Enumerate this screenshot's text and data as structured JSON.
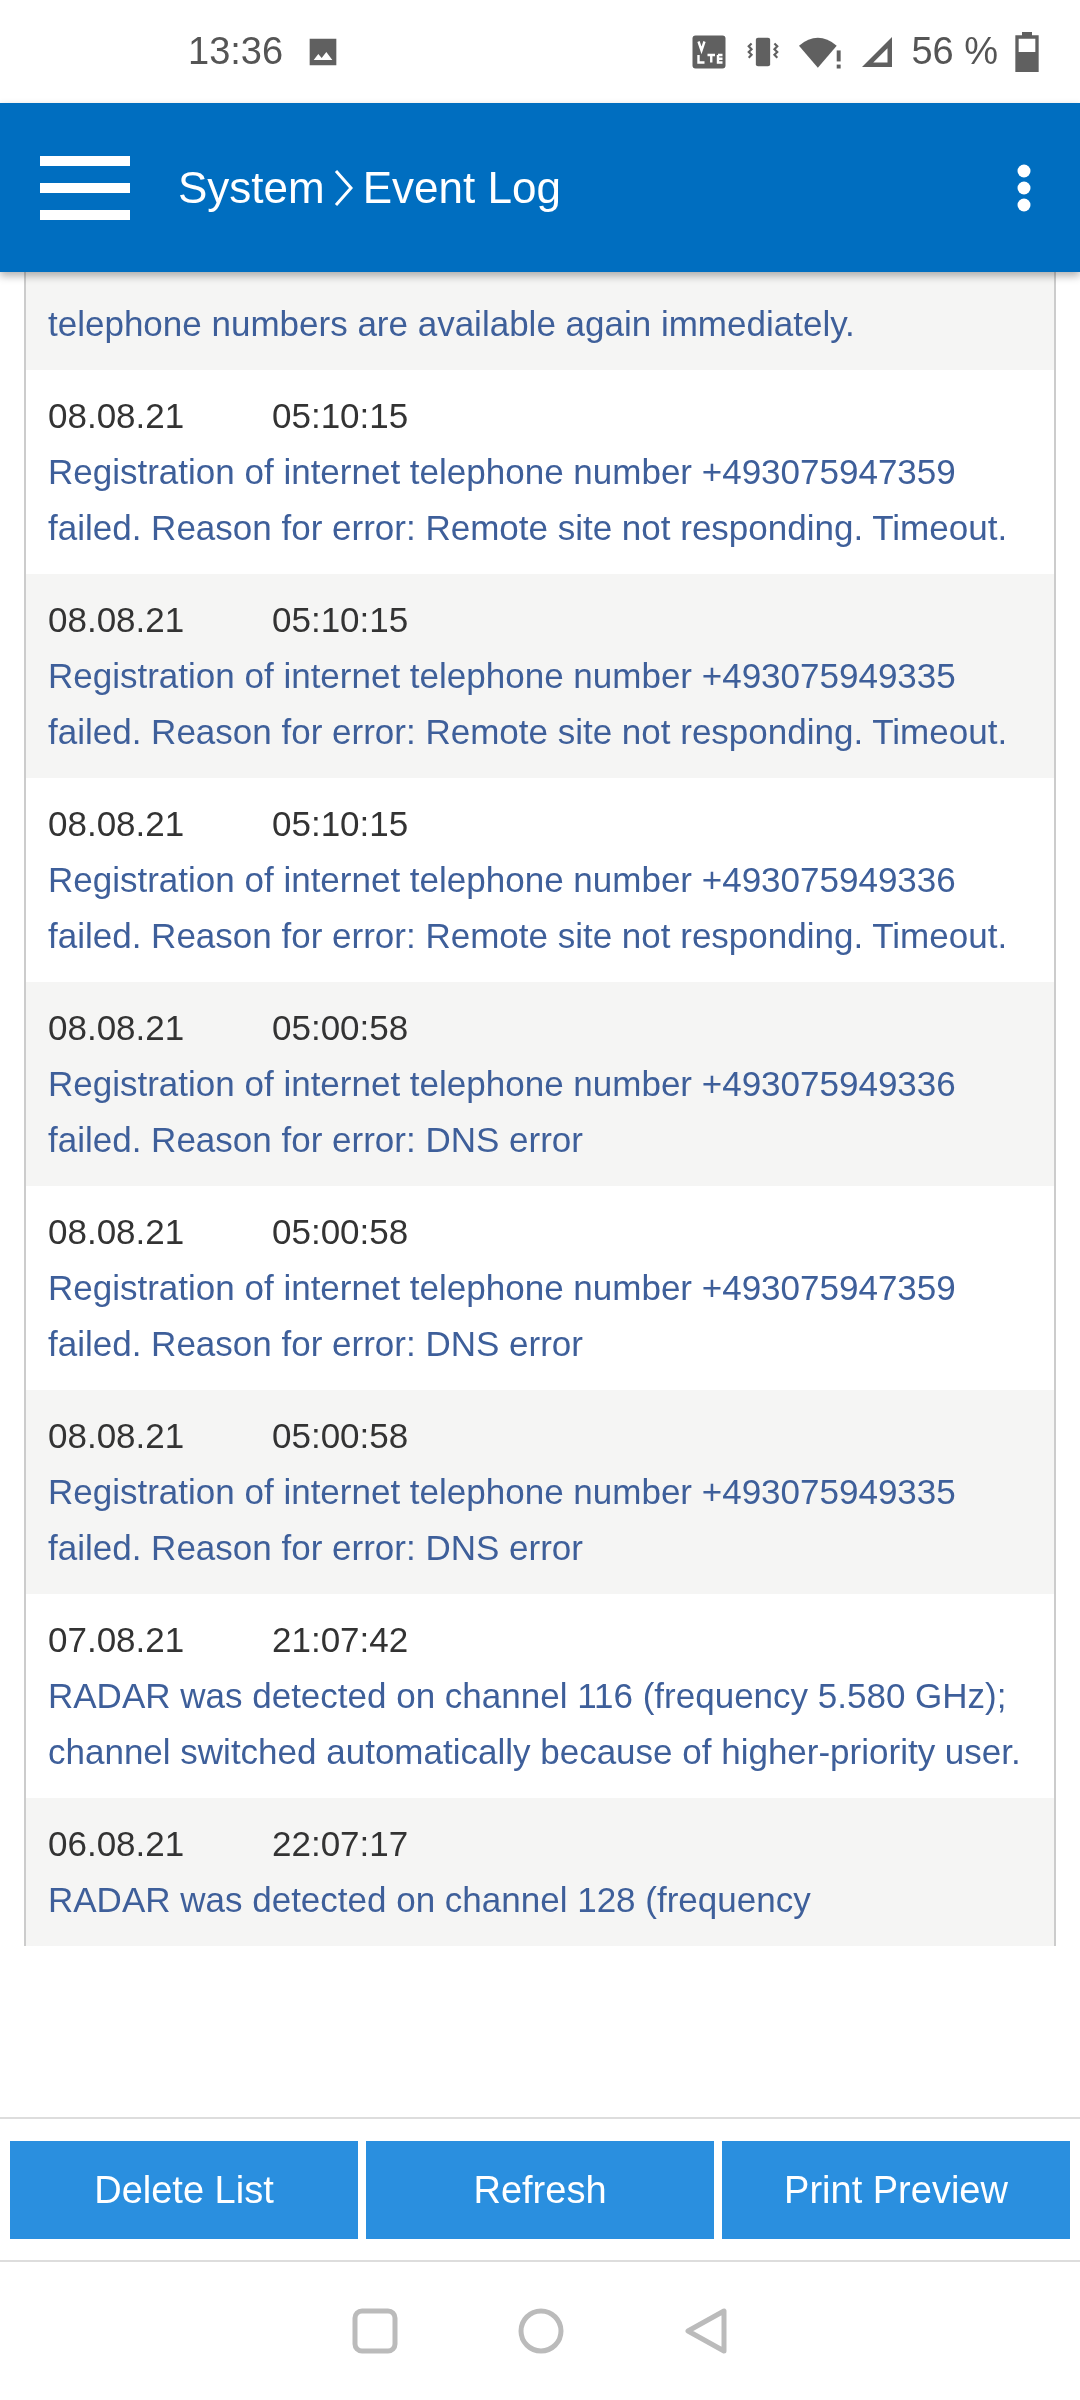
{
  "status_bar": {
    "time": "13:36",
    "battery": "56 %"
  },
  "header": {
    "title": "System",
    "subtitle": "Event Log"
  },
  "events": [
    {
      "message": "telephone numbers are available again immediately."
    },
    {
      "date": "08.08.21",
      "time": "05:10:15",
      "message": "Registration of internet telephone number +493075947359 failed. Reason for error: Remote site not responding. Timeout."
    },
    {
      "date": "08.08.21",
      "time": "05:10:15",
      "message": "Registration of internet telephone number +493075949335 failed. Reason for error: Remote site not responding. Timeout."
    },
    {
      "date": "08.08.21",
      "time": "05:10:15",
      "message": "Registration of internet telephone number +493075949336 failed. Reason for error: Remote site not responding. Timeout."
    },
    {
      "date": "08.08.21",
      "time": "05:00:58",
      "message": "Registration of internet telephone number +493075949336 failed. Reason for error: DNS error"
    },
    {
      "date": "08.08.21",
      "time": "05:00:58",
      "message": "Registration of internet telephone number +493075947359 failed. Reason for error: DNS error"
    },
    {
      "date": "08.08.21",
      "time": "05:00:58",
      "message": "Registration of internet telephone number +493075949335 failed. Reason for error: DNS error"
    },
    {
      "date": "07.08.21",
      "time": "21:07:42",
      "message": "RADAR was detected on channel 116 (frequency 5.580 GHz); channel switched automatically because of higher-priority user."
    },
    {
      "date": "06.08.21",
      "time": "22:07:17",
      "message": "RADAR was detected on channel 128 (frequency"
    }
  ],
  "buttons": [
    "Delete List",
    "Refresh",
    "Print Preview"
  ]
}
